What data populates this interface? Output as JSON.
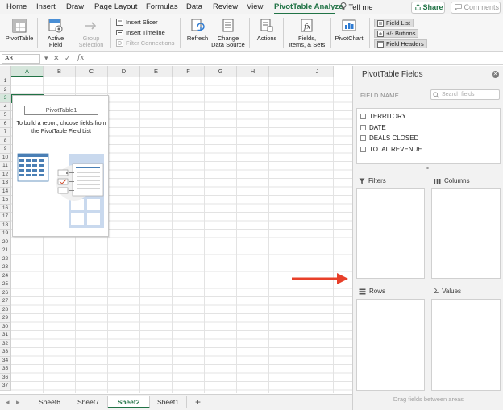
{
  "menu": {
    "tabs": [
      "Home",
      "Insert",
      "Draw",
      "Page Layout",
      "Formulas",
      "Data",
      "Review",
      "View",
      "PivotTable Analyze"
    ],
    "active_tab": "PivotTable Analyze",
    "tell_me": "Tell me",
    "share": "Share",
    "comments": "Comments"
  },
  "ribbon": {
    "pivottable": "PivotTable",
    "active_field_1": "Active",
    "active_field_2": "Field",
    "group_selection_1": "Group",
    "group_selection_2": "Selection",
    "insert_slicer": "Insert Slicer",
    "insert_timeline": "Insert Timeline",
    "filter_connections": "Filter Connections",
    "refresh": "Refresh",
    "change_data_source_1": "Change",
    "change_data_source_2": "Data Source",
    "actions": "Actions",
    "fields_items_sets_1": "Fields,",
    "fields_items_sets_2": "Items, & Sets",
    "pivotchart": "PivotChart",
    "field_list": "Field List",
    "plus_minus_buttons": "+/- Buttons",
    "field_headers": "Field Headers"
  },
  "formula_bar": {
    "name_box": "A3",
    "fx": "fx",
    "formula": ""
  },
  "grid": {
    "columns": [
      "A",
      "B",
      "C",
      "D",
      "E",
      "F",
      "G",
      "H",
      "I",
      "J"
    ],
    "rows": [
      "1",
      "2",
      "3",
      "4",
      "5",
      "6",
      "7",
      "8",
      "9",
      "10",
      "11",
      "12",
      "13",
      "14",
      "15",
      "16",
      "17",
      "18",
      "19",
      "20",
      "21",
      "22",
      "23",
      "24",
      "25",
      "26",
      "27",
      "28",
      "29",
      "30",
      "31",
      "32",
      "33",
      "34",
      "35",
      "36",
      "37"
    ],
    "selected_column": "A",
    "selected_row": "3"
  },
  "pivot_placeholder": {
    "name": "PivotTable1",
    "message": "To build a report, choose fields from the PivotTable Field List"
  },
  "sheets": {
    "tabs": [
      "Sheet6",
      "Sheet7",
      "Sheet2",
      "Sheet1"
    ],
    "active": "Sheet2",
    "add": "+"
  },
  "pane": {
    "title": "PivotTable Fields",
    "field_name_label": "FIELD NAME",
    "search_placeholder": "Search fields",
    "fields": [
      "TERRITORY",
      "DATE",
      "DEALS CLOSED",
      "TOTAL REVENUE"
    ],
    "filters": "Filters",
    "columns": "Columns",
    "rows": "Rows",
    "values": "Values",
    "drag_hint": "Drag fields between areas"
  },
  "colors": {
    "accent": "#217346",
    "arrow": "#e8402a"
  }
}
